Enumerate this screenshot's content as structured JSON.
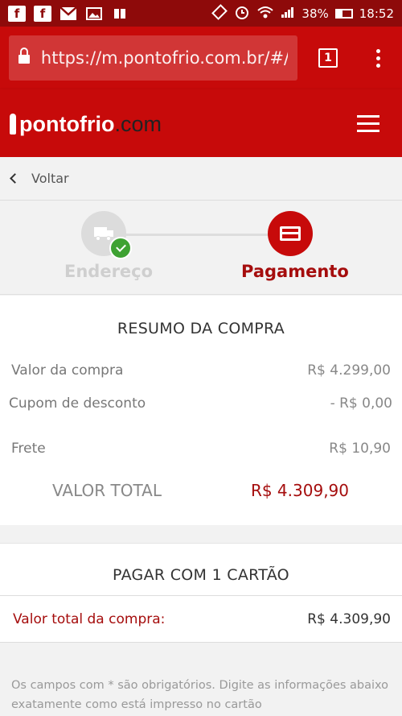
{
  "status_bar": {
    "battery": "38%",
    "time": "18:52"
  },
  "browser": {
    "url": "https://m.pontofrio.com.br/#/",
    "tab_count": "1"
  },
  "site": {
    "logo_main": "pontofrio",
    "logo_suffix": ".com"
  },
  "nav": {
    "back_label": "Voltar"
  },
  "steps": [
    {
      "label": "Endereço",
      "state": "done"
    },
    {
      "label": "Pagamento",
      "state": "active"
    }
  ],
  "summary": {
    "title": "RESUMO DA COMPRA",
    "rows": [
      {
        "label": "Valor da compra",
        "value": "R$ 4.299,00"
      },
      {
        "label": "Cupom de desconto",
        "value": "- R$ 0,00"
      },
      {
        "label": "Frete",
        "value": "R$ 10,90"
      }
    ],
    "total_label": "VALOR TOTAL",
    "total_value": "R$ 4.309,90"
  },
  "payment": {
    "title": "PAGAR COM 1 CARTÃO",
    "total_label": "Valor total da compra:",
    "total_value": "R$ 4.309,90"
  },
  "note": "Os campos com * são obrigatórios. Digite as informações abaixo exatamente como está impresso no cartão",
  "colors": {
    "brand_red": "#c70a0a",
    "dark_red": "#a50d0d",
    "status_bar": "#8e0a0a",
    "success_green": "#3ea232"
  }
}
